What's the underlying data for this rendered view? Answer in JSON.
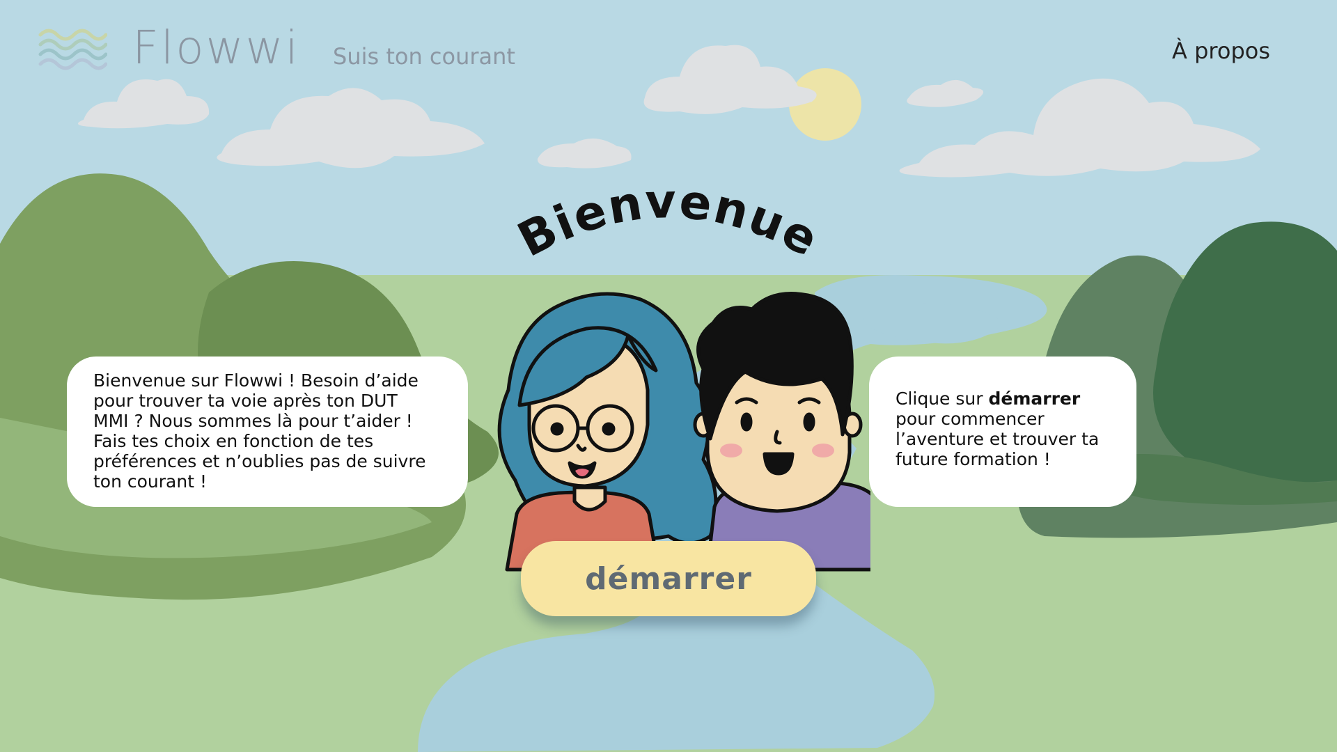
{
  "header": {
    "logo_text": "Flowwi",
    "tagline": "Suis ton courant",
    "about_label": "À propos"
  },
  "hero": {
    "title": "Bienvenue"
  },
  "bubbles": {
    "left": {
      "lines": [
        "Bienvenue sur Flowwi ! Besoin d’aide",
        "pour trouver ta voie après ton DUT",
        "MMI ? Nous sommes là pour t’aider !",
        "Fais tes choix en fonction de tes",
        "préférences et n’oublies pas de suivre",
        "ton courant !"
      ]
    },
    "right": {
      "prefix": "Clique sur ",
      "highlight": "démarrer",
      "lines": [
        "pour commencer",
        "l’aventure et trouver ta",
        "future formation !"
      ]
    }
  },
  "start_button": {
    "label": "démarrer"
  },
  "icons": {
    "logo": "waves-icon"
  },
  "colors": {
    "sky": "#b9d9e4",
    "meadow": "#b1d19e",
    "river": "#a9cfdc",
    "sun": "#ede4a8",
    "button": "#f8e5a2",
    "hair_girl": "#3e8bab",
    "shirt_girl": "#d7735f",
    "shirt_boy": "#8a7db8",
    "skin": "#f5dcb3"
  }
}
